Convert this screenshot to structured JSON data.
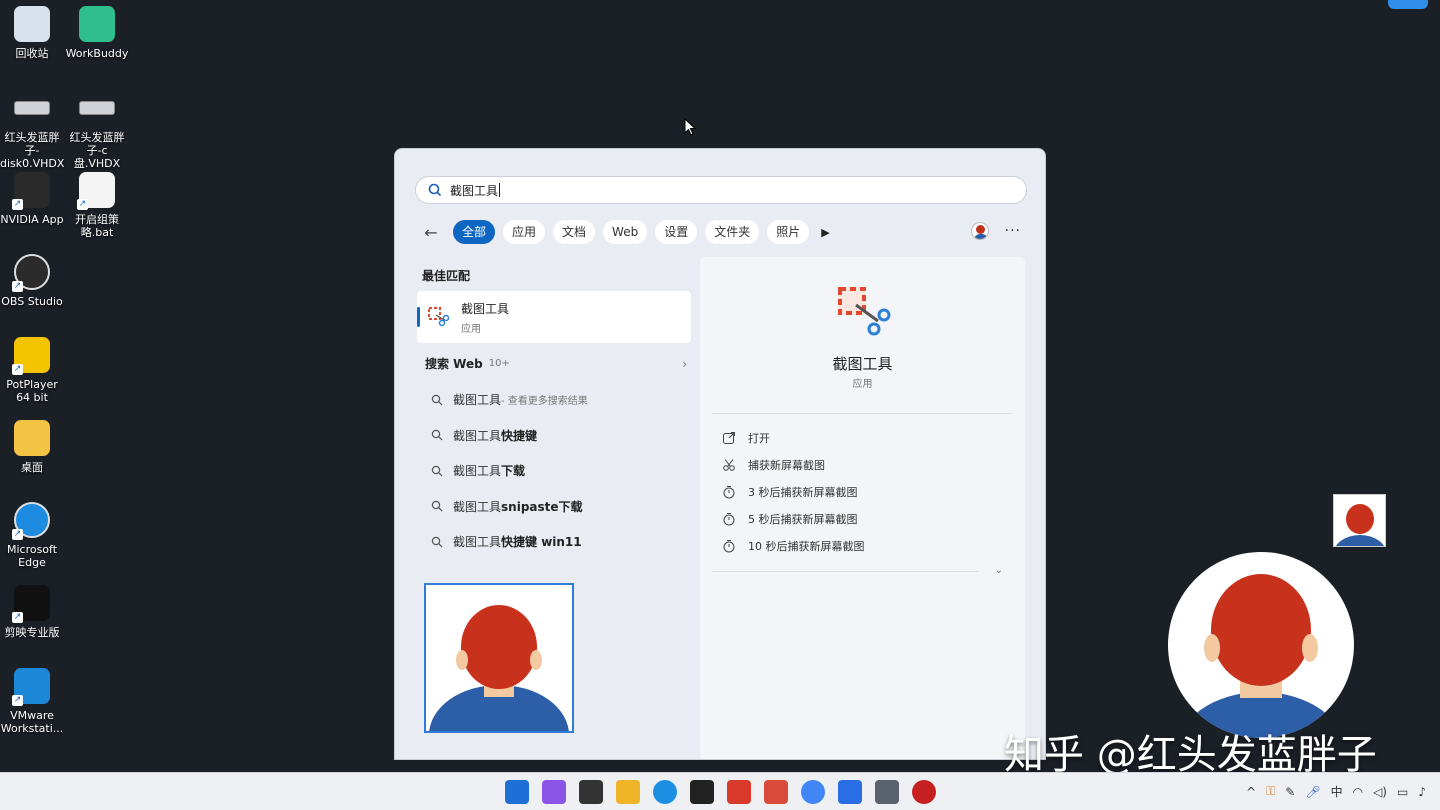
{
  "desktop": {
    "icons": [
      {
        "label": "回收站",
        "icon": "recycle-bin-icon"
      },
      {
        "label": "WorkBuddy",
        "icon": "workbuddy-icon"
      },
      {
        "label": "红头发蓝胖子-disk0.VHDX",
        "icon": "drive-icon"
      },
      {
        "label": "红头发蓝胖子-c盘.VHDX",
        "icon": "drive-icon"
      },
      {
        "label": "NVIDIA App",
        "icon": "nvidia-icon"
      },
      {
        "label": "开启组策略.bat",
        "icon": "bat-file-icon"
      },
      {
        "label": "OBS Studio",
        "icon": "obs-icon"
      },
      {
        "label": "PotPlayer 64 bit",
        "icon": "potplayer-icon"
      },
      {
        "label": "桌面",
        "icon": "folder-icon"
      },
      {
        "label": "Microsoft Edge",
        "icon": "edge-icon"
      },
      {
        "label": "剪映专业版",
        "icon": "capcut-icon"
      },
      {
        "label": "VMware Workstati...",
        "icon": "vmware-icon"
      }
    ]
  },
  "search": {
    "query": "截图工具",
    "filters": [
      "全部",
      "应用",
      "文档",
      "Web",
      "设置",
      "文件夹",
      "照片"
    ],
    "active_filter": "全部"
  },
  "results": {
    "best_match_heading": "最佳匹配",
    "best_match": {
      "name": "截图工具",
      "kind": "应用"
    },
    "web_heading": "搜索 Web",
    "web_count": "10+",
    "suggestions": [
      {
        "prefix": "截图工具",
        "bold": "",
        "hint": " - 查看更多搜索结果"
      },
      {
        "prefix": "截图工具",
        "bold": "快捷键",
        "hint": ""
      },
      {
        "prefix": "截图工具",
        "bold": "下载",
        "hint": ""
      },
      {
        "prefix": "截图工具",
        "bold": "snipaste下载",
        "hint": ""
      },
      {
        "prefix": "截图工具",
        "bold": "快捷键 win11",
        "hint": ""
      }
    ]
  },
  "detail": {
    "title": "截图工具",
    "kind": "应用",
    "actions": [
      {
        "label": "打开",
        "icon": "open-external-icon"
      },
      {
        "label": "捕获新屏幕截图",
        "icon": "snip-icon"
      },
      {
        "label": "3 秒后捕获新屏幕截图",
        "icon": "timer-icon"
      },
      {
        "label": "5 秒后捕获新屏幕截图",
        "icon": "timer-icon"
      },
      {
        "label": "10 秒后捕获新屏幕截图",
        "icon": "timer-icon"
      }
    ]
  },
  "taskbar": {
    "apps": [
      "start-icon",
      "copilot-icon",
      "task-view-icon",
      "file-explorer-icon",
      "edge-icon",
      "panda-icon",
      "wps-icon",
      "pdf-icon",
      "chrome-icon",
      "app-store-icon",
      "settings-icon",
      "record-icon"
    ],
    "tray": {
      "ime": "中"
    }
  },
  "watermark": "知乎 @红头发蓝胖子"
}
